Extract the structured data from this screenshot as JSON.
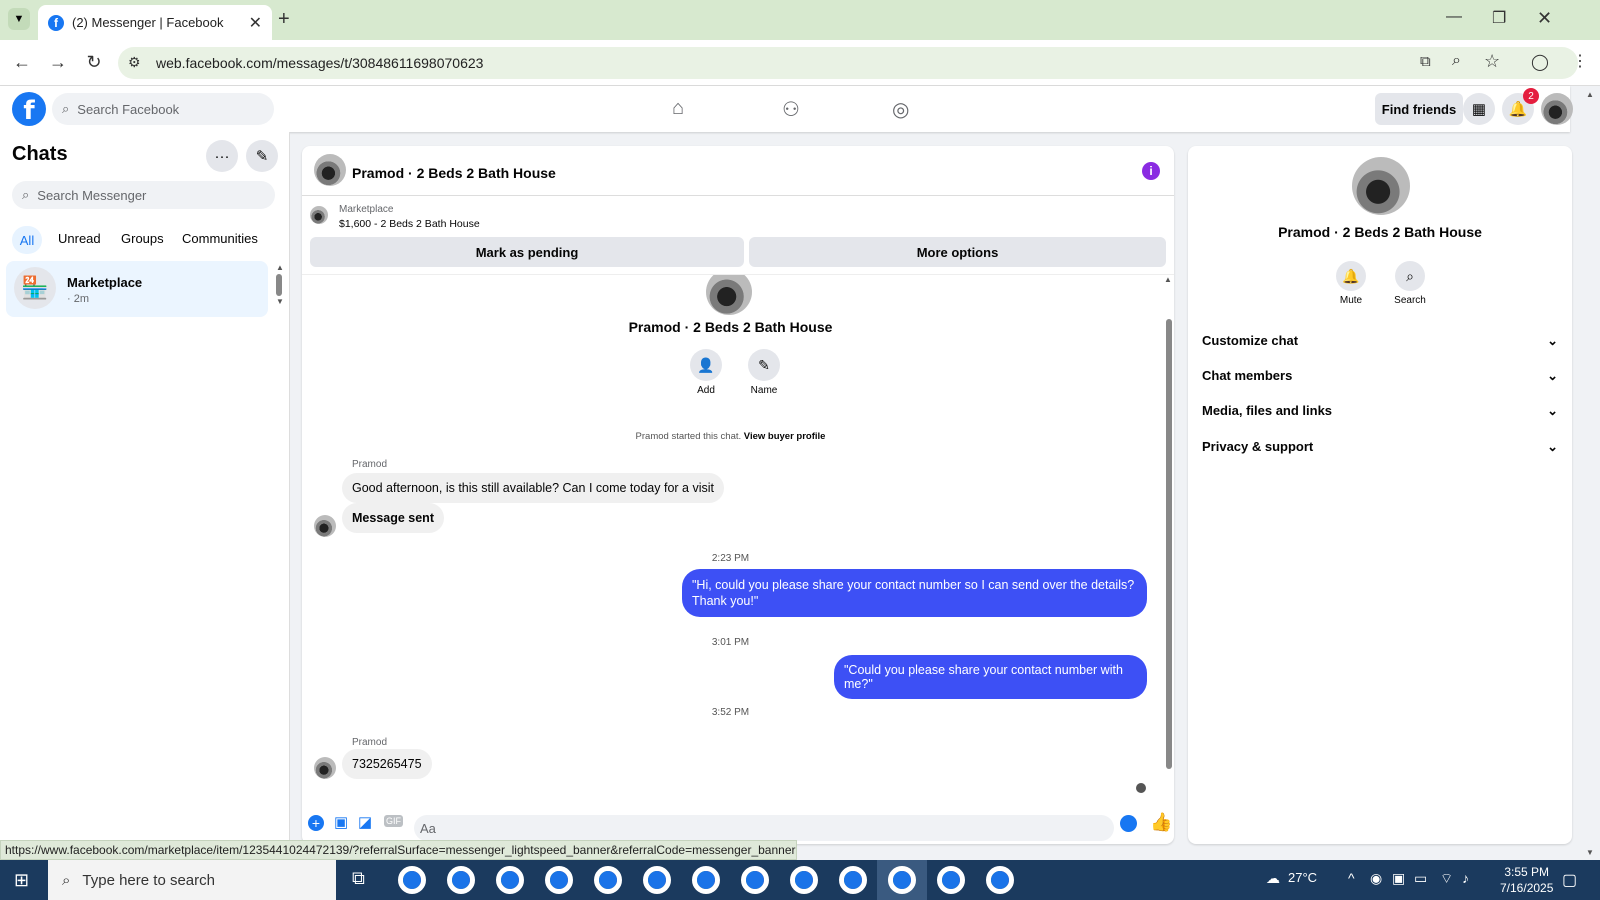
{
  "browser": {
    "tab_title": "(2) Messenger | Facebook",
    "url": "web.facebook.com/messages/t/30848611698070623",
    "new_tab": "+",
    "status_url": "https://www.facebook.com/marketplace/item/1235441024472139/?referralSurface=messenger_lightspeed_banner&referralCode=messenger_banner"
  },
  "fb_header": {
    "logo": "f",
    "search_placeholder": "Search Facebook",
    "find_friends": "Find friends",
    "notification_count": "2"
  },
  "sidebar": {
    "title": "Chats",
    "search_placeholder": "Search Messenger",
    "filters": [
      "All",
      "Unread",
      "Groups",
      "Communities"
    ],
    "chat_items": [
      {
        "name": "Marketplace",
        "subtitle": "· 2m"
      }
    ]
  },
  "conversation": {
    "title": "Pramod · 2 Beds 2 Bath House",
    "marketplace_label": "Marketplace",
    "listing": "$1,600 - 2 Beds 2 Bath House",
    "mark_pending": "Mark as pending",
    "more_options": "More options",
    "profile_name": "Pramod · 2 Beds 2 Bath House",
    "actions": [
      {
        "label": "Add",
        "icon": "add-person-icon"
      },
      {
        "label": "Name",
        "icon": "pencil-icon"
      }
    ],
    "started_text": "Pramod started this chat.",
    "view_buyer": "View buyer profile",
    "messages": {
      "sender1": "Pramod",
      "msg1": "Good afternoon, is this still available? Can I come today for a visit",
      "msg2": "Message sent",
      "ts1": "2:23 PM",
      "msg3": "\"Hi, could you please share your contact number so I can send over the details? Thank you!\"",
      "ts2": "3:01 PM",
      "msg4": "\"Could you please share your contact number with me?\"",
      "ts3": "3:52 PM",
      "sender2": "Pramod",
      "msg5": "7325265475"
    },
    "composer_placeholder": "Aa"
  },
  "details_panel": {
    "name": "Pramod · 2 Beds 2 Bath House",
    "mute_label": "Mute",
    "search_label": "Search",
    "sections": [
      "Customize chat",
      "Chat members",
      "Media, files and links",
      "Privacy & support"
    ]
  },
  "taskbar": {
    "search_placeholder": "Type here to search",
    "temperature": "27°C",
    "time": "3:55 PM",
    "date": "7/16/2025"
  },
  "colors": {
    "brand": "#1877f2",
    "outgoing_bubble": "#3d50f5",
    "info_button": "#8a2be2",
    "taskbar": "#1b3a5e"
  }
}
